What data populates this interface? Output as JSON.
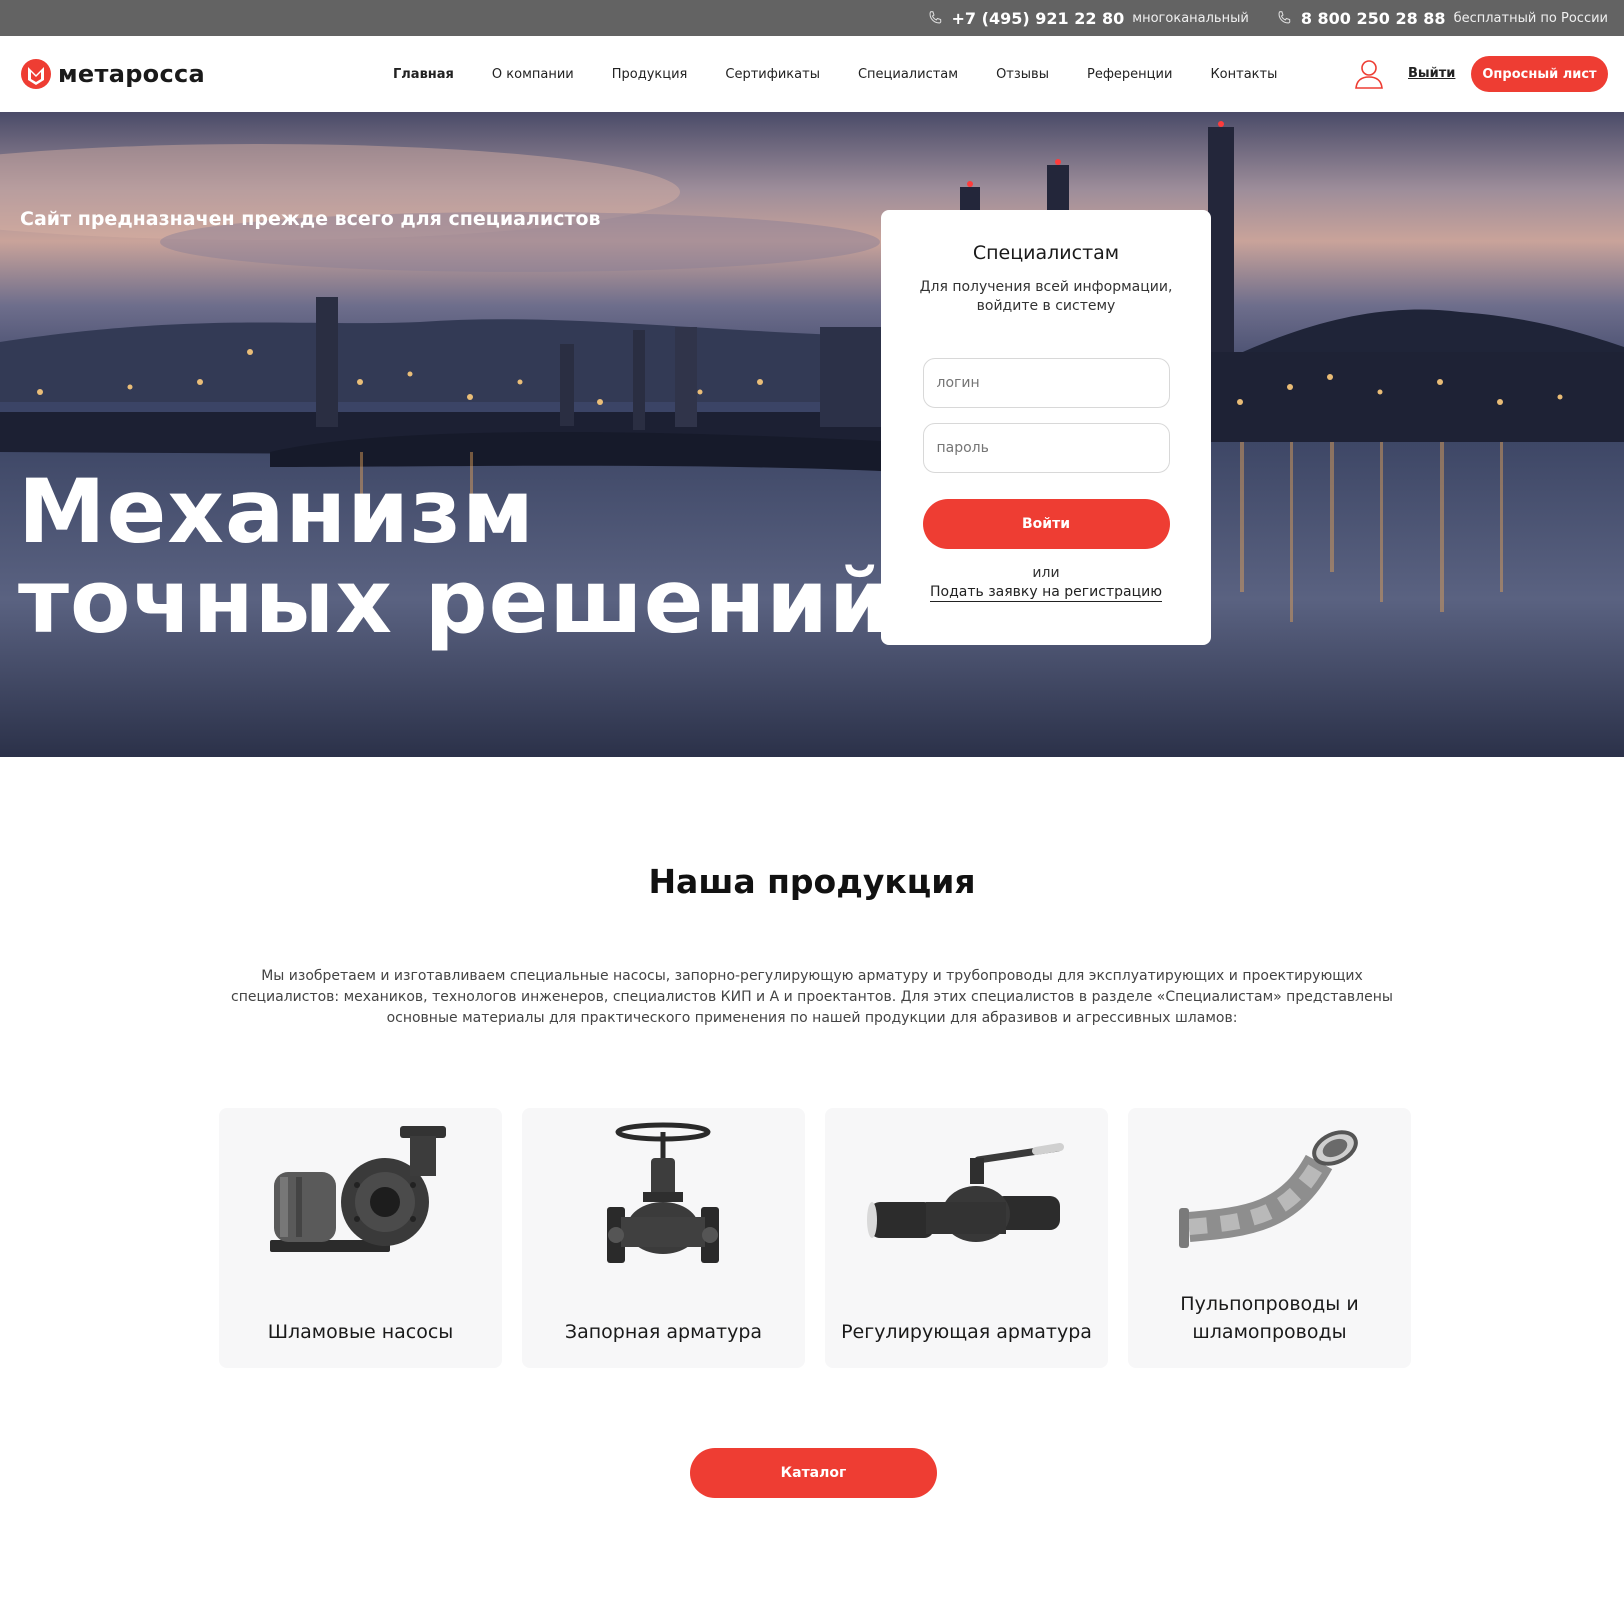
{
  "topbar": {
    "phones": [
      {
        "number": "+7 (495) 921 22 80",
        "note": "многоканальный"
      },
      {
        "number": "8 800 250 28 88",
        "note": "бесплатный по России"
      }
    ]
  },
  "header": {
    "logo_text": "метаросса",
    "nav": [
      "Главная",
      "О компании",
      "Продукция",
      "Сертификаты",
      "Специалистам",
      "Отзывы",
      "Референции",
      "Контакты"
    ],
    "active_nav": "Главная",
    "logout_label": "Выйти",
    "survey_label": "Опросный лист"
  },
  "hero": {
    "subtitle": "Сайт предназначен прежде всего для специалистов",
    "title_line1": "Механизм",
    "title_line2": "точных решений"
  },
  "login": {
    "title": "Специалистам",
    "description": "Для получения всей информации, войдите в систему",
    "login_placeholder": "логин",
    "password_placeholder": "пароль",
    "submit_label": "Войти",
    "or_label": "или",
    "register_link": "Подать заявку на регистрацию"
  },
  "products": {
    "title": "Наша продукция",
    "text": "Мы изобретаем и изготавливаем специальные насосы, запорно-регулирующую арматуру и трубопроводы для эксплуатирующих и проектирующих специалистов: механиков, технологов инженеров, специалистов КИП и А и проектантов. Для этих специалистов в разделе «Специалистам» представлены основные материалы для практического применения по нашей продукции для абразивов и агрессивных шламов:",
    "items": [
      {
        "label": "Шламовые насосы",
        "icon": "slurry-pump-icon"
      },
      {
        "label": "Запорная арматура",
        "icon": "globe-valve-icon"
      },
      {
        "label": "Регулирующая арматура",
        "icon": "ball-valve-icon"
      },
      {
        "label": "Пульпопроводы и шламопроводы",
        "icon": "pipe-bend-icon"
      }
    ],
    "catalog_label": "Каталог"
  },
  "colors": {
    "accent": "#ee3d33",
    "topbar": "#636363",
    "card_bg": "#f7f7f8"
  }
}
